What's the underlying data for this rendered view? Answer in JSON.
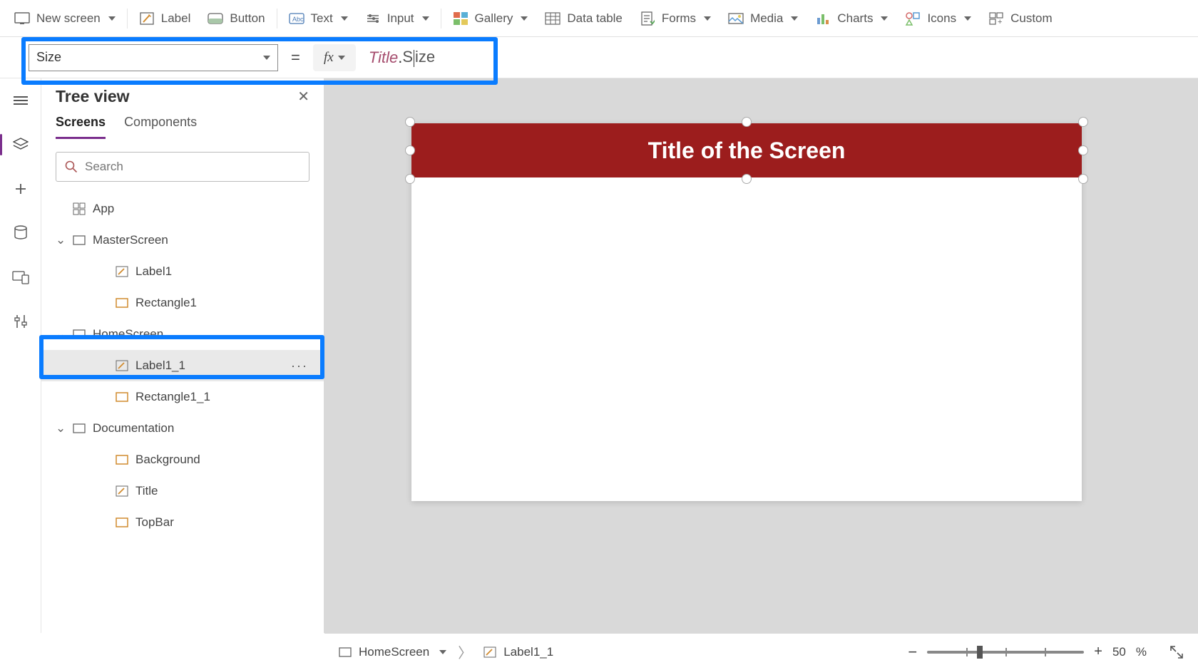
{
  "ribbon": {
    "new_screen": "New screen",
    "label": "Label",
    "button": "Button",
    "text": "Text",
    "input": "Input",
    "gallery": "Gallery",
    "data_table": "Data table",
    "forms": "Forms",
    "media": "Media",
    "charts": "Charts",
    "icons": "Icons",
    "custom": "Custom"
  },
  "formula": {
    "property": "Size",
    "object": "Title",
    "member": "Size",
    "equals": "="
  },
  "panel": {
    "title": "Tree view",
    "tabs": {
      "screens": "Screens",
      "components": "Components"
    },
    "search_placeholder": "Search",
    "nodes": {
      "app": "App",
      "master": "MasterScreen",
      "label1": "Label1",
      "rect1": "Rectangle1",
      "home": "HomeScreen",
      "label1_1": "Label1_1",
      "rect1_1": "Rectangle1_1",
      "doc": "Documentation",
      "background": "Background",
      "title": "Title",
      "topbar": "TopBar"
    }
  },
  "canvas": {
    "title_text": "Title of the Screen"
  },
  "status": {
    "screen": "HomeScreen",
    "element": "Label1_1",
    "zoom_value": "50",
    "zoom_pct": "%",
    "minus": "−",
    "plus": "+"
  }
}
